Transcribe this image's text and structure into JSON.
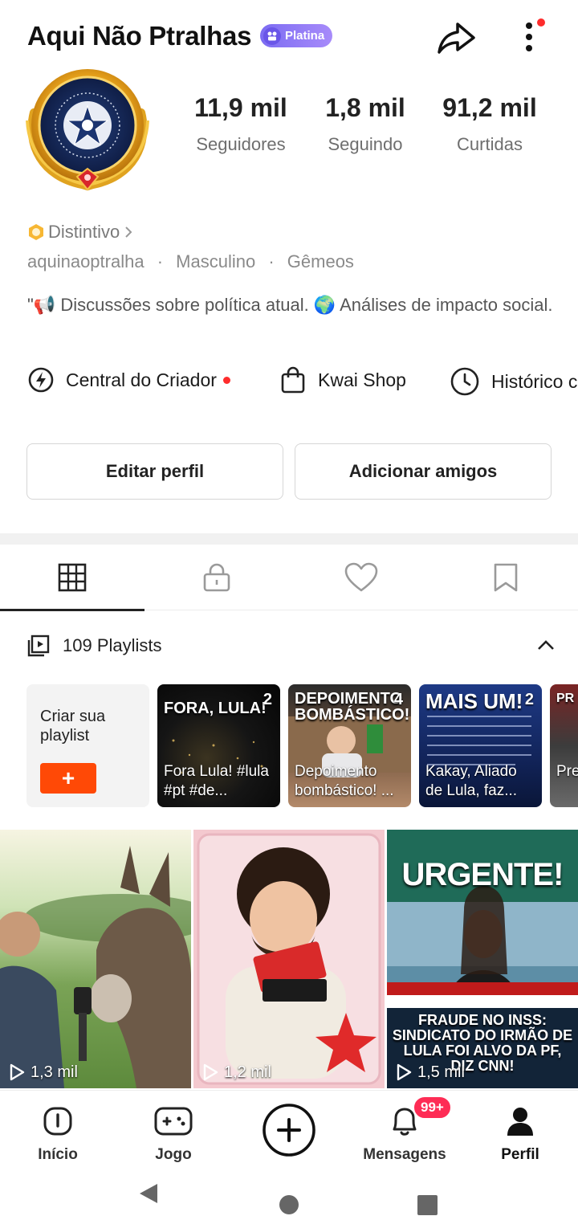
{
  "header": {
    "title": "Aqui Não Ptralhas",
    "badge": "Platina"
  },
  "stats": [
    {
      "value": "11,9 mil",
      "label": "Seguidores"
    },
    {
      "value": "1,8 mil",
      "label": "Seguindo"
    },
    {
      "value": "91,2 mil",
      "label": "Curtidas"
    }
  ],
  "profile": {
    "distintivo": "Distintivo",
    "username": "aquinaoptralha",
    "gender": "Masculino",
    "sign": "Gêmeos",
    "separator": "·",
    "bio": "\"📢 Discussões sobre política atual. 🌍 Análises de impacto social."
  },
  "quick_links": [
    {
      "label": "Central do Criador",
      "icon": "creator-icon"
    },
    {
      "label": "Kwai Shop",
      "icon": "shopping-bag-icon"
    },
    {
      "label": "Histórico c",
      "icon": "clock-icon"
    }
  ],
  "buttons": {
    "edit": "Editar perfil",
    "add_friends": "Adicionar amigos"
  },
  "tabs": [
    "grid-icon",
    "lock-icon",
    "heart-icon",
    "bookmark-icon"
  ],
  "playlists": {
    "header": "109 Playlists",
    "create_label": "Criar sua playlist",
    "create_plus": "+",
    "items": [
      {
        "count": "2",
        "headline": "FORA, LULA!",
        "caption": "Fora Lula! #lula #pt #de..."
      },
      {
        "count": "4",
        "headline": "DEPOIMENTO BOMBÁSTICO!",
        "caption": "Depoimento bombástico! ..."
      },
      {
        "count": "2",
        "headline": "MAIS UM!",
        "caption": "Kakay, Aliado de Lula, faz..."
      },
      {
        "count": "",
        "headline": "PR",
        "caption": "Pre o b"
      }
    ]
  },
  "videos": [
    {
      "views": "1,3 mil"
    },
    {
      "views": "1,2 mil"
    },
    {
      "views": "1,5 mil",
      "headline": "URGENTE!",
      "subtext": "FRAUDE NO INSS: SINDICATO DO IRMÃO DE LULA FOI ALVO DA PF, DIZ CNN!"
    }
  ],
  "bottom_nav": [
    {
      "label": "Início",
      "icon": "home-icon"
    },
    {
      "label": "Jogo",
      "icon": "gamepad-icon"
    },
    {
      "label": "",
      "icon": "plus-circle-icon"
    },
    {
      "label": "Mensagens",
      "icon": "bell-icon"
    },
    {
      "label": "Perfil",
      "icon": "person-icon"
    }
  ],
  "messages_badge": "99+"
}
